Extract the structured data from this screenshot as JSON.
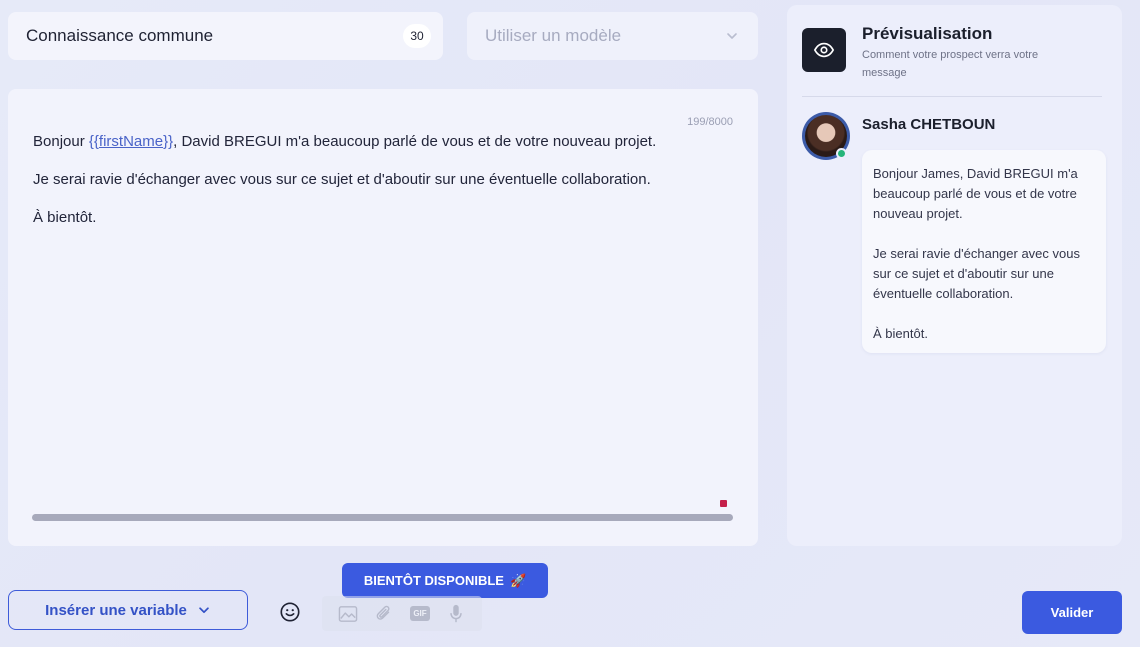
{
  "name_field": {
    "value": "Connaissance commune",
    "counter": "30"
  },
  "template_select": {
    "placeholder": "Utiliser un modèle",
    "icon": "chevron-down-icon"
  },
  "editor": {
    "char_count": "199/8000",
    "line1_prefix": "Bonjour ",
    "variable_open": "{{",
    "variable_name": "firstName",
    "variable_close": "}}",
    "line1_suffix": ", David BREGUI m'a beaucoup parlé de vous et de votre nouveau projet.",
    "line2": "Je serai ravie d'échanger avec vous sur ce sujet et d'aboutir sur une éventuelle collaboration.",
    "line3": "À bientôt."
  },
  "preview": {
    "icon": "eye-icon",
    "title": "Prévisualisation",
    "subtitle": "Comment votre prospect verra votre message",
    "sender_name": "Sasha CHETBOUN",
    "message_p1": "Bonjour James, David BREGUI m'a beaucoup parlé de vous et de votre nouveau projet.",
    "message_p2": "Je serai ravie d'échanger avec vous sur ce sujet et d'aboutir sur une éventuelle collaboration.",
    "message_p3": "À bientôt."
  },
  "toolbar": {
    "coming_soon_label": "BIENTÔT DISPONIBLE",
    "coming_soon_emoji": "🚀",
    "insert_variable_label": "Insérer une variable",
    "gif_label": "GIF",
    "validate_label": "Valider"
  },
  "colors": {
    "accent": "#3b5ae0",
    "online": "#25b57a",
    "marker": "#c41f4a"
  }
}
